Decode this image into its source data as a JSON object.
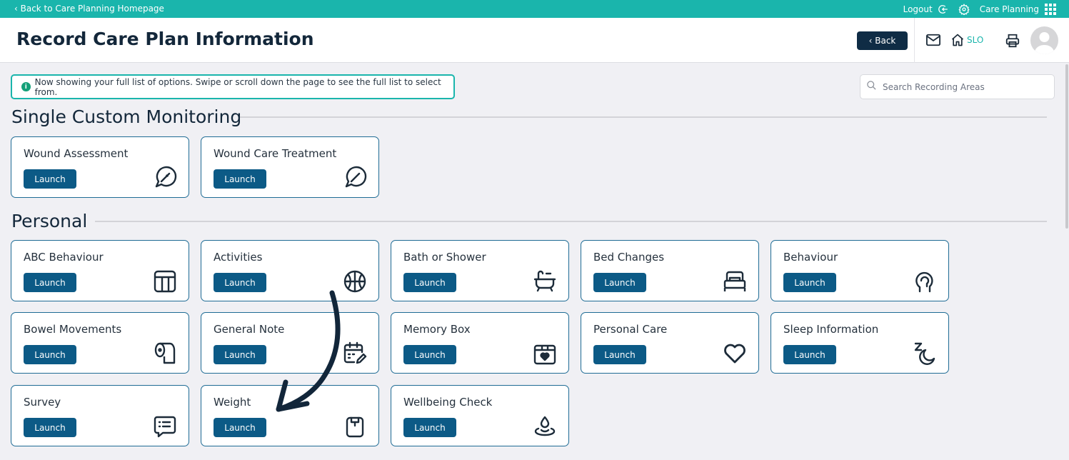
{
  "topbar": {
    "back_link": "‹ Back to Care Planning Homepage",
    "logout": "Logout",
    "app_name": "Care Planning"
  },
  "header": {
    "title": "Record Care Plan Information",
    "back_button": "‹ Back",
    "home_label": "SLO"
  },
  "notice": {
    "text": "Now showing your full list of options. Swipe or scroll down the page to see the full list to select from."
  },
  "search": {
    "placeholder": "Search Recording Areas"
  },
  "sections": [
    {
      "title": "Single Custom Monitoring",
      "cards": [
        {
          "name": "Wound Assessment",
          "launch": "Launch",
          "icon": "bandage-icon"
        },
        {
          "name": "Wound Care Treatment",
          "launch": "Launch",
          "icon": "bandage-icon"
        }
      ]
    },
    {
      "title": "Personal",
      "cards": [
        {
          "name": "ABC Behaviour",
          "launch": "Launch",
          "icon": "table-icon"
        },
        {
          "name": "Activities",
          "launch": "Launch",
          "icon": "ball-icon"
        },
        {
          "name": "Bath or Shower",
          "launch": "Launch",
          "icon": "bath-icon"
        },
        {
          "name": "Bed Changes",
          "launch": "Launch",
          "icon": "bed-icon"
        },
        {
          "name": "Behaviour",
          "launch": "Launch",
          "icon": "head-icon"
        },
        {
          "name": "Bowel Movements",
          "launch": "Launch",
          "icon": "toilet-roll-icon"
        },
        {
          "name": "General Note",
          "launch": "Launch",
          "icon": "calendar-edit-icon"
        },
        {
          "name": "Memory Box",
          "launch": "Launch",
          "icon": "memory-box-icon"
        },
        {
          "name": "Personal Care",
          "launch": "Launch",
          "icon": "heart-icon"
        },
        {
          "name": "Sleep Information",
          "launch": "Launch",
          "icon": "sleep-icon"
        },
        {
          "name": "Survey",
          "launch": "Launch",
          "icon": "survey-icon"
        },
        {
          "name": "Weight",
          "launch": "Launch",
          "icon": "scale-icon"
        },
        {
          "name": "Wellbeing Check",
          "launch": "Launch",
          "icon": "wellbeing-icon"
        }
      ]
    }
  ],
  "colors": {
    "teal": "#1ab5ac",
    "navy": "#0f2c45",
    "launch_blue": "#0c5a86",
    "card_border": "#1f6c95"
  }
}
